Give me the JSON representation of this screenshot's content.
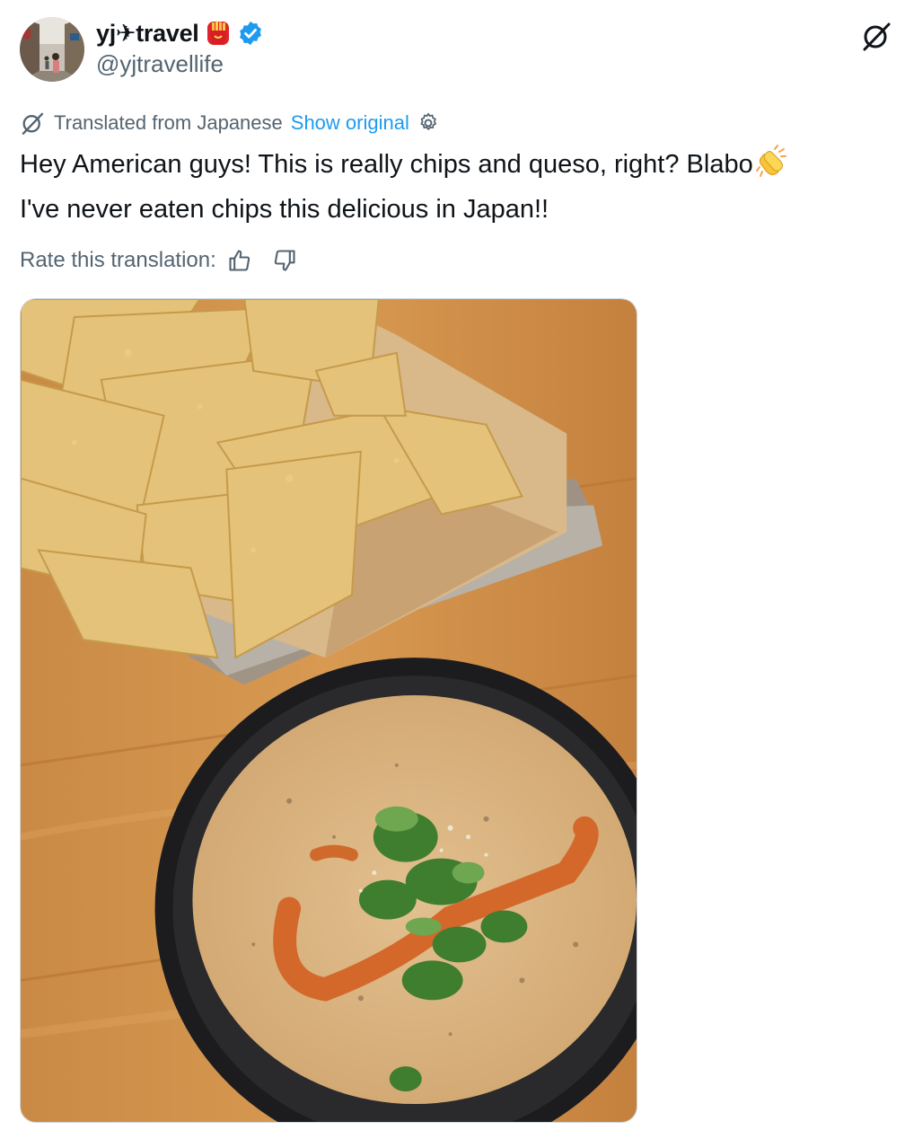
{
  "author": {
    "display_name": "yj✈travel",
    "handle": "@yjtravellife",
    "verified": true,
    "badge_emoji_icon": "fries-icon",
    "avatar_icon": "street-photo-avatar"
  },
  "translation": {
    "label": "Translated from Japanese",
    "show_original": "Show original",
    "settings_icon": "gear-icon"
  },
  "tweet": {
    "line1": "Hey American guys! This is really chips and queso, right? Blabo",
    "line1_emoji": "clapping-hands-icon",
    "line2": "I've never eaten chips this delicious in Japan!!"
  },
  "rate": {
    "label": "Rate this translation:",
    "up_icon": "thumbs-up-icon",
    "down_icon": "thumbs-down-icon"
  },
  "media": {
    "description_icon": "chips-and-queso-photo"
  },
  "colors": {
    "text": "#0f1419",
    "secondary": "#536471",
    "link": "#1d9bf0",
    "verified": "#1d9bf0"
  }
}
